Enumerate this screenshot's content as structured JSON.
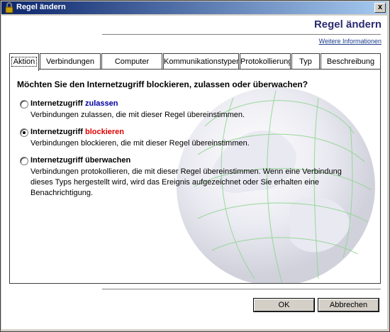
{
  "window": {
    "title": "Regel ändern",
    "close_glyph": "x"
  },
  "header": {
    "title": "Regel ändern",
    "more_info": "Weitere Informationen"
  },
  "tabs": [
    {
      "label": "Aktion",
      "active": true
    },
    {
      "label": "Verbindungen",
      "active": false
    },
    {
      "label": "Computer",
      "active": false
    },
    {
      "label": "Kommunikationstypen",
      "active": false
    },
    {
      "label": "Protokollierung",
      "active": false
    },
    {
      "label": "Typ",
      "active": false
    },
    {
      "label": "Beschreibung",
      "active": false
    }
  ],
  "panel": {
    "question": "Möchten Sie den Internetzugriff blockieren, zulassen oder überwachen?",
    "options": [
      {
        "title_prefix": "Internetzugriff ",
        "title_keyword": "zulassen",
        "description": "Verbindungen zulassen, die mit dieser Regel übereinstimmen.",
        "selected": false
      },
      {
        "title_prefix": "Internetzugriff ",
        "title_keyword": "blockieren",
        "description": "Verbindungen blockieren, die mit dieser Regel übereinstimmen.",
        "selected": true
      },
      {
        "title_prefix": "Internetzugriff überwachen",
        "title_keyword": "",
        "description": "Verbindungen protokollieren, die mit dieser Regel übereinstimmen. Wenn eine Verbindung dieses Typs hergestellt wird, wird das Ereignis aufgezeichnet oder Sie erhalten eine Benachrichtigung.",
        "selected": false
      }
    ]
  },
  "buttons": {
    "ok": "OK",
    "cancel": "Abbrechen"
  },
  "colors": {
    "allow": "#0000a0",
    "block": "#e00000",
    "header": "#2b2b70"
  }
}
